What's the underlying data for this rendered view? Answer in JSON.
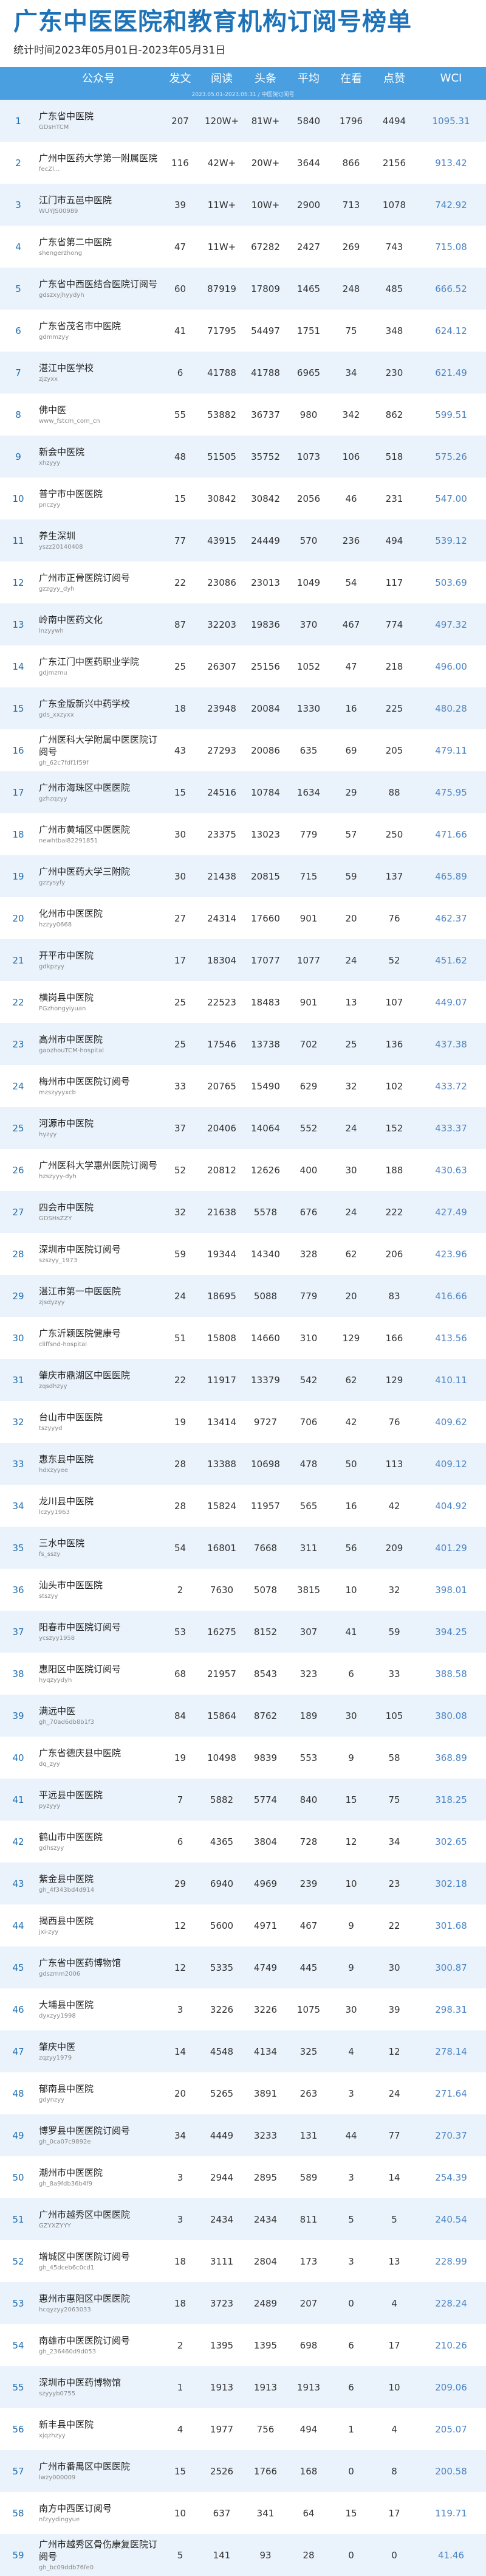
{
  "header": {
    "title": "广东中医医院和教育机构订阅号榜单",
    "subtitle": "统计时间2023年05月01日-2023年05月31日"
  },
  "table": {
    "columns": [
      "公众号",
      "发文",
      "阅读",
      "头条",
      "平均",
      "在看",
      "点赞",
      "WCI"
    ],
    "watermark": "2023.05.01-2023.05.31 / 中医院订阅号",
    "rows": [
      {
        "rank": "1",
        "name": "广东省中医院",
        "id": "GDsHTCM",
        "posts": "207",
        "reads": "120W+",
        "headline": "81W+",
        "avg": "5840",
        "watching": "1796",
        "likes": "4494",
        "wci": "1095.31"
      },
      {
        "rank": "2",
        "name": "广州中医药大学第一附属医院",
        "id": "fecZl...",
        "posts": "116",
        "reads": "42W+",
        "headline": "20W+",
        "avg": "3644",
        "watching": "866",
        "likes": "2156",
        "wci": "913.42"
      },
      {
        "rank": "3",
        "name": "江门市五邑中医院",
        "id": "WUYJS00989",
        "posts": "39",
        "reads": "11W+",
        "headline": "10W+",
        "avg": "2900",
        "watching": "713",
        "likes": "1078",
        "wci": "742.92"
      },
      {
        "rank": "4",
        "name": "广东省第二中医院",
        "id": "shengerzhong",
        "posts": "47",
        "reads": "11W+",
        "headline": "67282",
        "avg": "2427",
        "watching": "269",
        "likes": "743",
        "wci": "715.08"
      },
      {
        "rank": "5",
        "name": "广东省中西医结合医院订阅号",
        "id": "gdszxyjhyydyh",
        "posts": "60",
        "reads": "87919",
        "headline": "17809",
        "avg": "1465",
        "watching": "248",
        "likes": "485",
        "wci": "666.52"
      },
      {
        "rank": "6",
        "name": "广东省茂名市中医院",
        "id": "gdmmzyy",
        "posts": "41",
        "reads": "71795",
        "headline": "54497",
        "avg": "1751",
        "watching": "75",
        "likes": "348",
        "wci": "624.12"
      },
      {
        "rank": "7",
        "name": "湛江中医学校",
        "id": "zjzyxx",
        "posts": "6",
        "reads": "41788",
        "headline": "41788",
        "avg": "6965",
        "watching": "34",
        "likes": "230",
        "wci": "621.49"
      },
      {
        "rank": "8",
        "name": "佛中医",
        "id": "www_fstcm_com_cn",
        "posts": "55",
        "reads": "53882",
        "headline": "36737",
        "avg": "980",
        "watching": "342",
        "likes": "862",
        "wci": "599.51"
      },
      {
        "rank": "9",
        "name": "新会中医院",
        "id": "xhzyyy",
        "posts": "48",
        "reads": "51505",
        "headline": "35752",
        "avg": "1073",
        "watching": "106",
        "likes": "518",
        "wci": "575.26"
      },
      {
        "rank": "10",
        "name": "普宁市中医医院",
        "id": "pnczyy",
        "posts": "15",
        "reads": "30842",
        "headline": "30842",
        "avg": "2056",
        "watching": "46",
        "likes": "231",
        "wci": "547.00"
      },
      {
        "rank": "11",
        "name": "养生深圳",
        "id": "yszz20140408",
        "posts": "77",
        "reads": "43915",
        "headline": "24449",
        "avg": "570",
        "watching": "236",
        "likes": "494",
        "wci": "539.12"
      },
      {
        "rank": "12",
        "name": "广州市正骨医院订阅号",
        "id": "gzzgyy_dyh",
        "posts": "22",
        "reads": "23086",
        "headline": "23013",
        "avg": "1049",
        "watching": "54",
        "likes": "117",
        "wci": "503.69"
      },
      {
        "rank": "13",
        "name": "岭南中医药文化",
        "id": "lnzyywh",
        "posts": "87",
        "reads": "32203",
        "headline": "19836",
        "avg": "370",
        "watching": "467",
        "likes": "774",
        "wci": "497.32"
      },
      {
        "rank": "14",
        "name": "广东江门中医药职业学院",
        "id": "gdjmzmu",
        "posts": "25",
        "reads": "26307",
        "headline": "25156",
        "avg": "1052",
        "watching": "47",
        "likes": "218",
        "wci": "496.00"
      },
      {
        "rank": "15",
        "name": "广东金版新兴中药学校",
        "id": "gds_xxzyxx",
        "posts": "18",
        "reads": "23948",
        "headline": "20084",
        "avg": "1330",
        "watching": "16",
        "likes": "225",
        "wci": "480.28"
      },
      {
        "rank": "16",
        "name": "广州医科大学附属中医医院订阅号",
        "id": "gh_62c7fdf1f59f",
        "posts": "43",
        "reads": "27293",
        "headline": "20086",
        "avg": "635",
        "watching": "69",
        "likes": "205",
        "wci": "479.11"
      },
      {
        "rank": "17",
        "name": "广州市海珠区中医医院",
        "id": "gzhzqzyy",
        "posts": "15",
        "reads": "24516",
        "headline": "10784",
        "avg": "1634",
        "watching": "29",
        "likes": "88",
        "wci": "475.95"
      },
      {
        "rank": "18",
        "name": "广州市黄埔区中医医院",
        "id": "newhtbai82291851",
        "posts": "30",
        "reads": "23375",
        "headline": "13023",
        "avg": "779",
        "watching": "57",
        "likes": "250",
        "wci": "471.66"
      },
      {
        "rank": "19",
        "name": "广州中医药大学三附院",
        "id": "gzzysyfy",
        "posts": "30",
        "reads": "21438",
        "headline": "20815",
        "avg": "715",
        "watching": "59",
        "likes": "137",
        "wci": "465.89"
      },
      {
        "rank": "20",
        "name": "化州市中医医院",
        "id": "hzzyy0668",
        "posts": "27",
        "reads": "24314",
        "headline": "17660",
        "avg": "901",
        "watching": "20",
        "likes": "76",
        "wci": "462.37"
      },
      {
        "rank": "21",
        "name": "开平市中医院",
        "id": "gdkpzyy",
        "posts": "17",
        "reads": "18304",
        "headline": "17077",
        "avg": "1077",
        "watching": "24",
        "likes": "52",
        "wci": "451.62"
      },
      {
        "rank": "22",
        "name": "横岗县中医院",
        "id": "FGzhongyiyuan",
        "posts": "25",
        "reads": "22523",
        "headline": "18483",
        "avg": "901",
        "watching": "13",
        "likes": "107",
        "wci": "449.07"
      },
      {
        "rank": "23",
        "name": "高州市中医医院",
        "id": "gaozhouTCM-hospital",
        "posts": "25",
        "reads": "17546",
        "headline": "13738",
        "avg": "702",
        "watching": "25",
        "likes": "136",
        "wci": "437.38"
      },
      {
        "rank": "24",
        "name": "梅州市中医医院订阅号",
        "id": "mzszyyyxcb",
        "posts": "33",
        "reads": "20765",
        "headline": "15490",
        "avg": "629",
        "watching": "32",
        "likes": "102",
        "wci": "433.72"
      },
      {
        "rank": "25",
        "name": "河源市中医院",
        "id": "hyzyy",
        "posts": "37",
        "reads": "20406",
        "headline": "14064",
        "avg": "552",
        "watching": "24",
        "likes": "152",
        "wci": "433.37"
      },
      {
        "rank": "26",
        "name": "广州医科大学惠州医院订阅号",
        "id": "hzszyyy-dyh",
        "posts": "52",
        "reads": "20812",
        "headline": "12626",
        "avg": "400",
        "watching": "30",
        "likes": "188",
        "wci": "430.63"
      },
      {
        "rank": "27",
        "name": "四会市中医院",
        "id": "GDSHsZZY",
        "posts": "32",
        "reads": "21638",
        "headline": "5578",
        "avg": "676",
        "watching": "24",
        "likes": "222",
        "wci": "427.49"
      },
      {
        "rank": "28",
        "name": "深圳市中医院订阅号",
        "id": "szszyy_1973",
        "posts": "59",
        "reads": "19344",
        "headline": "14340",
        "avg": "328",
        "watching": "62",
        "likes": "206",
        "wci": "423.96"
      },
      {
        "rank": "29",
        "name": "湛江市第一中医医院",
        "id": "zjsdyzyy",
        "posts": "24",
        "reads": "18695",
        "headline": "5088",
        "avg": "779",
        "watching": "20",
        "likes": "83",
        "wci": "416.66"
      },
      {
        "rank": "30",
        "name": "广东沂颖医院健康号",
        "id": "cliffsnd-hospital",
        "posts": "51",
        "reads": "15808",
        "headline": "14660",
        "avg": "310",
        "watching": "129",
        "likes": "166",
        "wci": "413.56"
      },
      {
        "rank": "31",
        "name": "肇庆市鼎湖区中医医院",
        "id": "zqsdhzyy",
        "posts": "22",
        "reads": "11917",
        "headline": "13379",
        "avg": "542",
        "watching": "62",
        "likes": "129",
        "wci": "410.11"
      },
      {
        "rank": "32",
        "name": "台山市中医医院",
        "id": "tszyyyd",
        "posts": "19",
        "reads": "13414",
        "headline": "9727",
        "avg": "706",
        "watching": "42",
        "likes": "76",
        "wci": "409.62"
      },
      {
        "rank": "33",
        "name": "惠东县中医院",
        "id": "hdxzyyee",
        "posts": "28",
        "reads": "13388",
        "headline": "10698",
        "avg": "478",
        "watching": "50",
        "likes": "113",
        "wci": "409.12"
      },
      {
        "rank": "34",
        "name": "龙川县中医院",
        "id": "lczyy1963",
        "posts": "28",
        "reads": "15824",
        "headline": "11957",
        "avg": "565",
        "watching": "16",
        "likes": "42",
        "wci": "404.92"
      },
      {
        "rank": "35",
        "name": "三水中医院",
        "id": "fs_sszy",
        "posts": "54",
        "reads": "16801",
        "headline": "7668",
        "avg": "311",
        "watching": "56",
        "likes": "209",
        "wci": "401.29"
      },
      {
        "rank": "36",
        "name": "汕头市中医医院",
        "id": "stszyy",
        "posts": "2",
        "reads": "7630",
        "headline": "5078",
        "avg": "3815",
        "watching": "10",
        "likes": "32",
        "wci": "398.01"
      },
      {
        "rank": "37",
        "name": "阳春市中医院订阅号",
        "id": "ycszyy1958",
        "posts": "53",
        "reads": "16275",
        "headline": "8152",
        "avg": "307",
        "watching": "41",
        "likes": "59",
        "wci": "394.25"
      },
      {
        "rank": "38",
        "name": "惠阳区中医院订阅号",
        "id": "hyqzyydyh",
        "posts": "68",
        "reads": "21957",
        "headline": "8543",
        "avg": "323",
        "watching": "6",
        "likes": "33",
        "wci": "388.58"
      },
      {
        "rank": "39",
        "name": "满远中医",
        "id": "gh_70ad6db8b1f3",
        "posts": "84",
        "reads": "15864",
        "headline": "8762",
        "avg": "189",
        "watching": "30",
        "likes": "105",
        "wci": "380.08"
      },
      {
        "rank": "40",
        "name": "广东省德庆县中医院",
        "id": "dq_zyy",
        "posts": "19",
        "reads": "10498",
        "headline": "9839",
        "avg": "553",
        "watching": "9",
        "likes": "58",
        "wci": "368.89"
      },
      {
        "rank": "41",
        "name": "平远县中医医院",
        "id": "pyzyyy",
        "posts": "7",
        "reads": "5882",
        "headline": "5774",
        "avg": "840",
        "watching": "15",
        "likes": "75",
        "wci": "318.25"
      },
      {
        "rank": "42",
        "name": "鹤山市中医医院",
        "id": "gdhszyy",
        "posts": "6",
        "reads": "4365",
        "headline": "3804",
        "avg": "728",
        "watching": "12",
        "likes": "34",
        "wci": "302.65"
      },
      {
        "rank": "43",
        "name": "紫金县中医院",
        "id": "gh_4f343bd4d914",
        "posts": "29",
        "reads": "6940",
        "headline": "4969",
        "avg": "239",
        "watching": "10",
        "likes": "23",
        "wci": "302.18"
      },
      {
        "rank": "44",
        "name": "揭西县中医院",
        "id": "jxi-zyy",
        "posts": "12",
        "reads": "5600",
        "headline": "4971",
        "avg": "467",
        "watching": "9",
        "likes": "22",
        "wci": "301.68"
      },
      {
        "rank": "45",
        "name": "广东省中医药博物馆",
        "id": "gdszmm2006",
        "posts": "12",
        "reads": "5335",
        "headline": "4749",
        "avg": "445",
        "watching": "9",
        "likes": "30",
        "wci": "300.87"
      },
      {
        "rank": "46",
        "name": "大埔县中医院",
        "id": "dyxzyy1998",
        "posts": "3",
        "reads": "3226",
        "headline": "3226",
        "avg": "1075",
        "watching": "30",
        "likes": "39",
        "wci": "298.31"
      },
      {
        "rank": "47",
        "name": "肇庆中医",
        "id": "zqzyy1979",
        "posts": "14",
        "reads": "4548",
        "headline": "4134",
        "avg": "325",
        "watching": "4",
        "likes": "12",
        "wci": "278.14"
      },
      {
        "rank": "48",
        "name": "郁南县中医院",
        "id": "gdynzyy",
        "posts": "20",
        "reads": "5265",
        "headline": "3891",
        "avg": "263",
        "watching": "3",
        "likes": "24",
        "wci": "271.64"
      },
      {
        "rank": "49",
        "name": "博罗县中医医院订阅号",
        "id": "gh_0ca07c9892e",
        "posts": "34",
        "reads": "4449",
        "headline": "3233",
        "avg": "131",
        "watching": "44",
        "likes": "77",
        "wci": "270.37"
      },
      {
        "rank": "50",
        "name": "潮州市中医医院",
        "id": "gh_8a9fdb36b4f9",
        "posts": "3",
        "reads": "2944",
        "headline": "2895",
        "avg": "589",
        "watching": "3",
        "likes": "14",
        "wci": "254.39"
      },
      {
        "rank": "51",
        "name": "广州市越秀区中医医院",
        "id": "GZYXZYYY",
        "posts": "3",
        "reads": "2434",
        "headline": "2434",
        "avg": "811",
        "watching": "5",
        "likes": "5",
        "wci": "240.54"
      },
      {
        "rank": "52",
        "name": "增城区中医医院订阅号",
        "id": "gh_45dceb6c0cd1",
        "posts": "18",
        "reads": "3111",
        "headline": "2804",
        "avg": "173",
        "watching": "3",
        "likes": "13",
        "wci": "228.99"
      },
      {
        "rank": "53",
        "name": "惠州市惠阳区中医医院",
        "id": "hcqyzyy2063033",
        "posts": "18",
        "reads": "3723",
        "headline": "2489",
        "avg": "207",
        "watching": "0",
        "likes": "4",
        "wci": "228.24"
      },
      {
        "rank": "54",
        "name": "南雄市中医医院订阅号",
        "id": "gh_236460d9d053",
        "posts": "2",
        "reads": "1395",
        "headline": "1395",
        "avg": "698",
        "watching": "6",
        "likes": "17",
        "wci": "210.26"
      },
      {
        "rank": "55",
        "name": "深圳市中医药博物馆",
        "id": "szyyyb0755",
        "posts": "1",
        "reads": "1913",
        "headline": "1913",
        "avg": "1913",
        "watching": "6",
        "likes": "10",
        "wci": "209.06"
      },
      {
        "rank": "56",
        "name": "新丰县中医院",
        "id": "xjqzhzyy",
        "posts": "4",
        "reads": "1977",
        "headline": "756",
        "avg": "494",
        "watching": "1",
        "likes": "4",
        "wci": "205.07"
      },
      {
        "rank": "57",
        "name": "广州市番禺区中医医院",
        "id": "lwzy000009",
        "posts": "15",
        "reads": "2526",
        "headline": "1766",
        "avg": "168",
        "watching": "0",
        "likes": "8",
        "wci": "200.58"
      },
      {
        "rank": "58",
        "name": "南方中西医订阅号",
        "id": "nfzyydingyue",
        "posts": "10",
        "reads": "637",
        "headline": "341",
        "avg": "64",
        "watching": "15",
        "likes": "17",
        "wci": "119.71"
      },
      {
        "rank": "59",
        "name": "广州市越秀区骨伤康复医院订阅号",
        "id": "gh_bc09ddb76fe0",
        "posts": "5",
        "reads": "141",
        "headline": "93",
        "avg": "28",
        "watching": "0",
        "likes": "0",
        "wci": "41.46"
      }
    ]
  }
}
